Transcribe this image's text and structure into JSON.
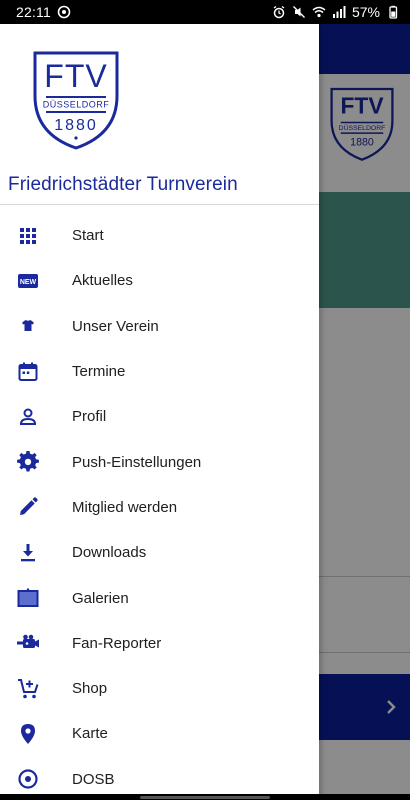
{
  "status_bar": {
    "time": "22:11",
    "battery": "57%",
    "icons": [
      "notification-icon",
      "alarm-icon",
      "mute-icon",
      "wifi-icon",
      "signal-icon",
      "battery-icon"
    ]
  },
  "drawer": {
    "logo": {
      "letters": "FTV",
      "city": "DÜSSELDORF",
      "year": "1880"
    },
    "club_name": "Friedrichstädter Turnverein",
    "accent_color": "#1a2a9c",
    "items": [
      {
        "label": "Start",
        "icon": "grid-icon"
      },
      {
        "label": "Aktuelles",
        "icon": "new-badge-icon"
      },
      {
        "label": "Unser Verein",
        "icon": "jersey-icon"
      },
      {
        "label": "Termine",
        "icon": "calendar-icon"
      },
      {
        "label": "Profil",
        "icon": "person-icon"
      },
      {
        "label": "Push-Einstellungen",
        "icon": "gear-icon"
      },
      {
        "label": "Mitglied werden",
        "icon": "pencil-icon"
      },
      {
        "label": "Downloads",
        "icon": "download-icon"
      },
      {
        "label": "Galerien",
        "icon": "gallery-icon"
      },
      {
        "label": "Fan-Reporter",
        "icon": "camera-icon"
      },
      {
        "label": "Shop",
        "icon": "cart-add-icon"
      },
      {
        "label": "Karte",
        "icon": "map-pin-icon"
      },
      {
        "label": "DOSB",
        "icon": "target-icon"
      }
    ]
  },
  "background": {
    "brand_color": "#0a1f9a"
  }
}
